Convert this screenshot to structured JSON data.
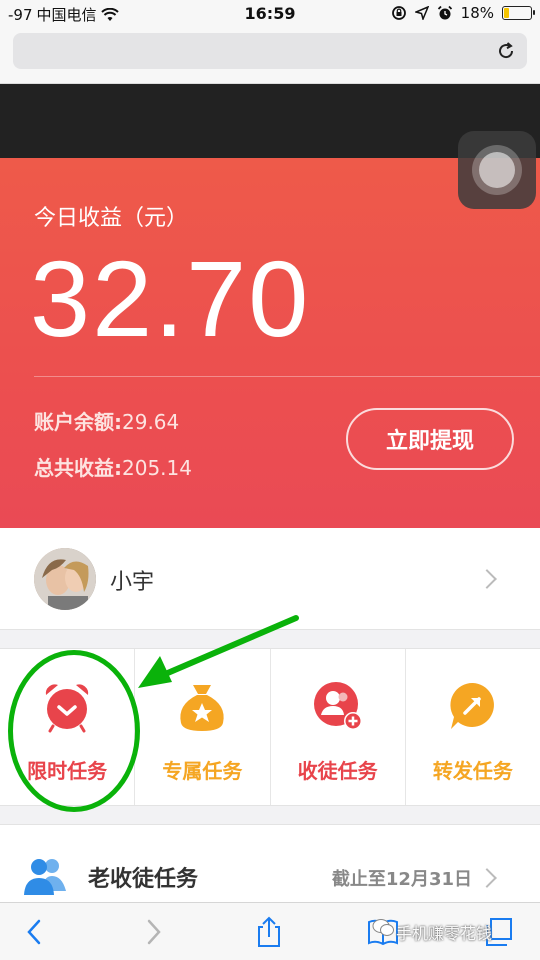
{
  "status_bar": {
    "signal": "-97",
    "carrier": "中国电信",
    "time": "16:59",
    "battery_percent": "18%",
    "battery_level": 0.18,
    "icons": [
      "wifi-icon",
      "rotation-lock-icon",
      "location-icon",
      "alarm-icon",
      "battery-icon"
    ]
  },
  "browser": {
    "address_text": "",
    "reload_icon": "reload-icon"
  },
  "earnings": {
    "title": "今日收益（元）",
    "amount": "32.70",
    "balance_label": "账户余额:",
    "balance_value": "29.64",
    "total_label": "总共收益:",
    "total_value": "205.14",
    "withdraw_label": "立即提现",
    "color_top": "#ee5a4a",
    "color_bottom": "#ea4a55"
  },
  "user": {
    "name": "小宇"
  },
  "tasks": [
    {
      "label": "限时任务",
      "icon": "alarm-clock-icon",
      "color": "#e8444b"
    },
    {
      "label": "专属任务",
      "icon": "money-bag-star-icon",
      "color": "#f5a623"
    },
    {
      "label": "收徒任务",
      "icon": "add-user-icon",
      "color": "#e8444b"
    },
    {
      "label": "转发任务",
      "icon": "share-bubble-icon",
      "color": "#f5a623"
    }
  ],
  "old_task": {
    "title": "老收徒任务",
    "deadline": "截止至12月31日",
    "icon": "users-icon",
    "icon_color": "#2f8ce6"
  },
  "toolbar": {
    "icons": [
      "back-icon",
      "forward-icon",
      "share-icon",
      "bookmarks-icon",
      "tabs-icon"
    ]
  },
  "watermark": {
    "text": "手机赚零花钱"
  },
  "annotation": {
    "color": "#0ab20a"
  }
}
